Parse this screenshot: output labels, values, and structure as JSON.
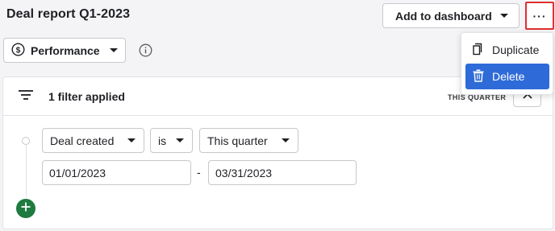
{
  "header": {
    "title": "Deal report Q1-2023",
    "add_button_label": "Add to dashboard",
    "more_button_label": "···"
  },
  "toolbar": {
    "view_label": "Performance"
  },
  "filter_panel": {
    "summary": "1 filter applied",
    "period_tag": "THIS QUARTER",
    "rule": {
      "field": "Deal created",
      "operator": "is",
      "value": "This quarter",
      "date_from": "01/01/2023",
      "date_separator": "-",
      "date_to": "03/31/2023"
    }
  },
  "menu": {
    "items": [
      {
        "label": "Duplicate",
        "icon": "copy-icon"
      },
      {
        "label": "Delete",
        "icon": "trash-icon",
        "highlighted": true
      }
    ]
  },
  "colors": {
    "accent": "#2f6bd8",
    "add_filter": "#1f7a3f",
    "focus_outline": "#e02f2f"
  }
}
